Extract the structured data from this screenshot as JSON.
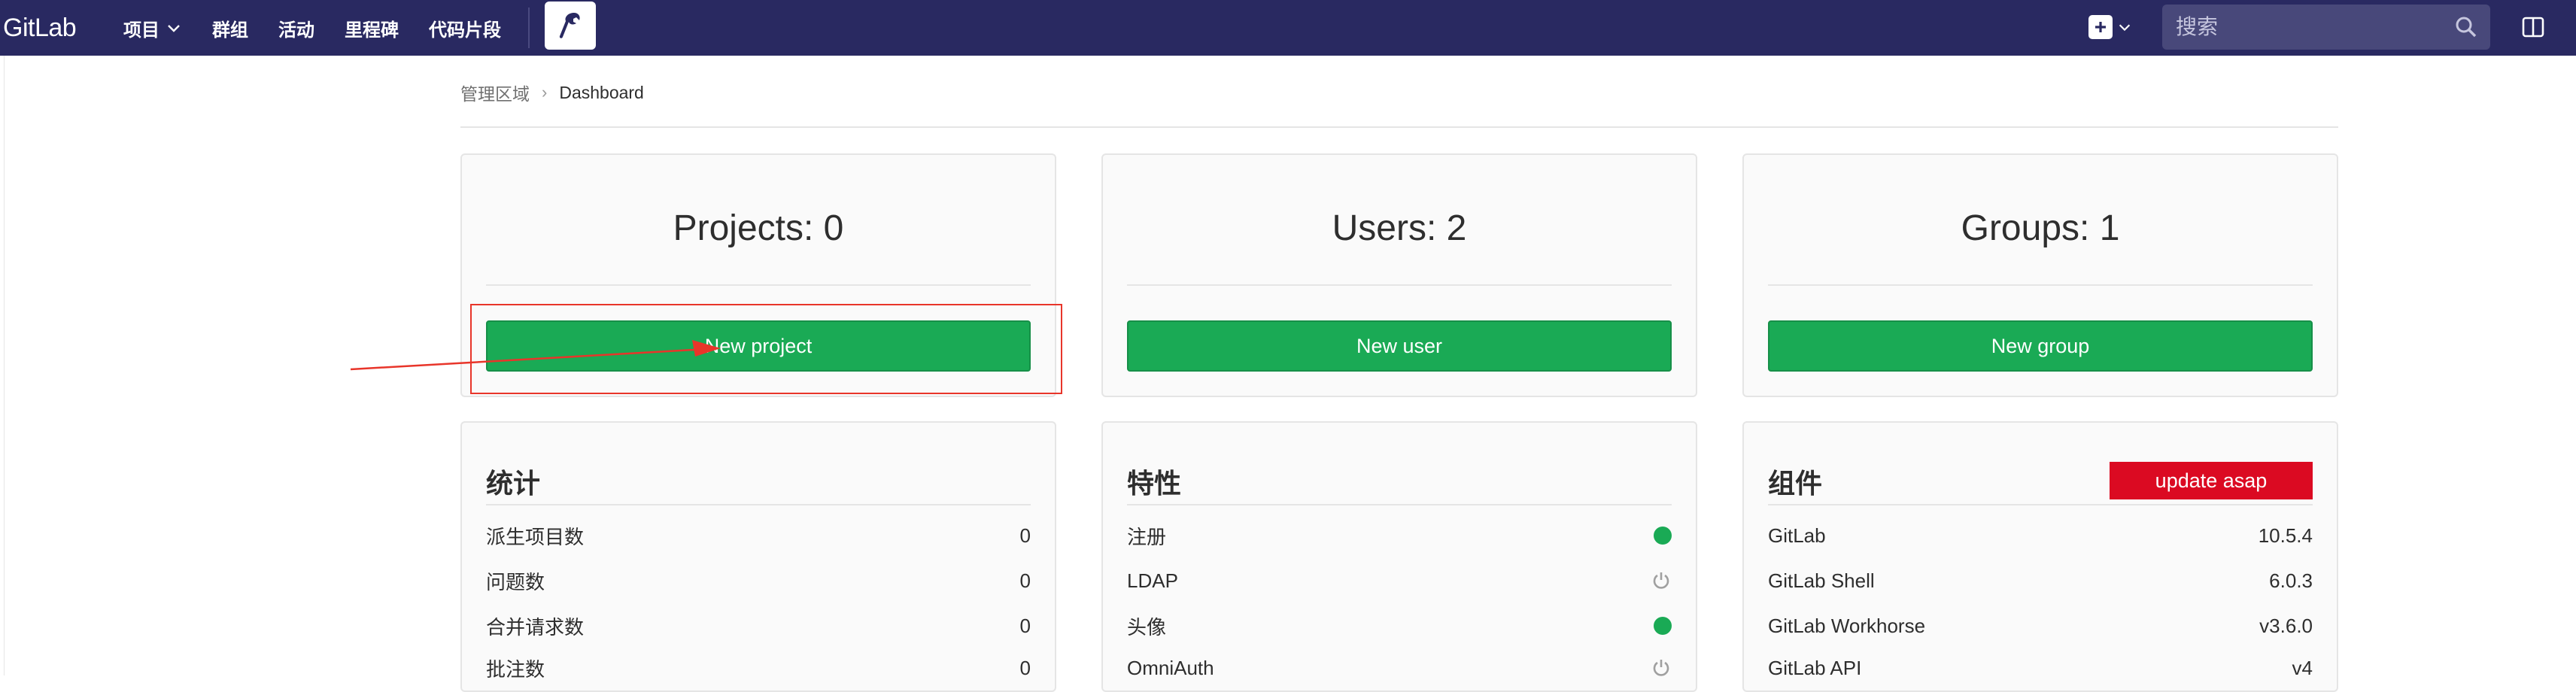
{
  "navbar": {
    "brand": "GitLab",
    "links": [
      {
        "label": "项目"
      },
      {
        "label": "群组"
      },
      {
        "label": "活动"
      },
      {
        "label": "里程碑"
      },
      {
        "label": "代码片段"
      }
    ],
    "search_placeholder": "搜索",
    "colors": {
      "background": "#292961"
    }
  },
  "breadcrumb": {
    "parent": "管理区域",
    "current": "Dashboard"
  },
  "summary_cards": [
    {
      "title": "Projects: 0",
      "button_label": "New project"
    },
    {
      "title": "Users: 2",
      "button_label": "New user"
    },
    {
      "title": "Groups: 1",
      "button_label": "New group"
    }
  ],
  "stats": {
    "title": "统计",
    "rows": [
      {
        "label": "派生项目数",
        "value": "0"
      },
      {
        "label": "问题数",
        "value": "0"
      },
      {
        "label": "合并请求数",
        "value": "0"
      },
      {
        "label": "批注数",
        "value": "0"
      }
    ]
  },
  "features": {
    "title": "特性",
    "rows": [
      {
        "label": "注册",
        "status": "on"
      },
      {
        "label": "LDAP",
        "status": "off"
      },
      {
        "label": "头像",
        "status": "on"
      },
      {
        "label": "OmniAuth",
        "status": "off"
      }
    ]
  },
  "components": {
    "title": "组件",
    "update_badge": "update asap",
    "rows": [
      {
        "label": "GitLab",
        "value": "10.5.4"
      },
      {
        "label": "GitLab Shell",
        "value": "6.0.3"
      },
      {
        "label": "GitLab Workhorse",
        "value": "v3.6.0"
      },
      {
        "label": "GitLab API",
        "value": "v4"
      }
    ]
  },
  "colors": {
    "accent_green": "#1aaa55",
    "update_red": "#db0a22",
    "annotation_red": "#e8352a"
  }
}
